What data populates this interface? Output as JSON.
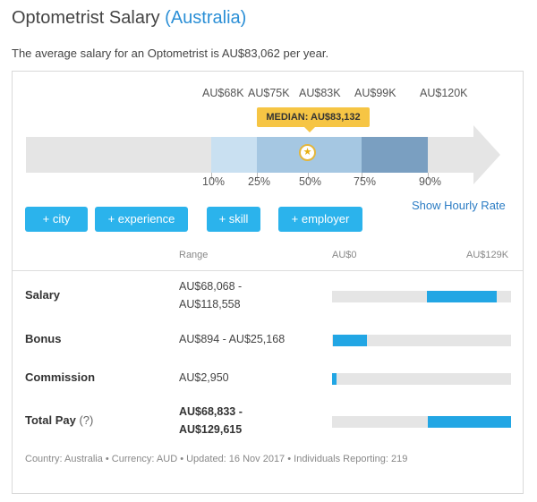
{
  "header": {
    "title": "Optometrist Salary",
    "country": "(Australia)",
    "subtitle": "The average salary for an Optometrist is AU$83,062 per year."
  },
  "percentile_chart": {
    "values": [
      "AU$68K",
      "AU$75K",
      "AU$83K",
      "AU$99K",
      "AU$120K"
    ],
    "median_label": "MEDIAN: AU$83,132",
    "percentiles": [
      "10%",
      "25%",
      "50%",
      "75%",
      "90%"
    ],
    "median_icon": "star-icon"
  },
  "filters": {
    "buttons": [
      "+ city",
      "+ experience",
      "+ skill",
      "+ employer"
    ],
    "hourly_link": "Show Hourly Rate"
  },
  "table": {
    "range_header": "Range",
    "min_header": "AU$0",
    "max_header": "AU$129K",
    "scale_max": 129000,
    "rows": [
      {
        "label": "Salary",
        "range_line1": "AU$68,068 -",
        "range_line2": "AU$118,558",
        "low": 68068,
        "high": 118558
      },
      {
        "label": "Bonus",
        "range_line1": "AU$894 - AU$25,168",
        "range_line2": "",
        "low": 894,
        "high": 25168
      },
      {
        "label": "Commission",
        "range_line1": "AU$2,950",
        "range_line2": "",
        "low": 0,
        "high": 2950
      },
      {
        "label": "Total Pay",
        "help": "(?)",
        "range_line1": "AU$68,833 -",
        "range_line2": "AU$129,615",
        "low": 68833,
        "high": 129615
      }
    ]
  },
  "footer": "Country: Australia  •  Currency: AUD  •  Updated: 16 Nov 2017  •  Individuals Reporting: 219",
  "colors": {
    "accent": "#2bb3ec",
    "link": "#2b7cc4",
    "median": "#f6c544",
    "bar": "#22a6e4"
  }
}
